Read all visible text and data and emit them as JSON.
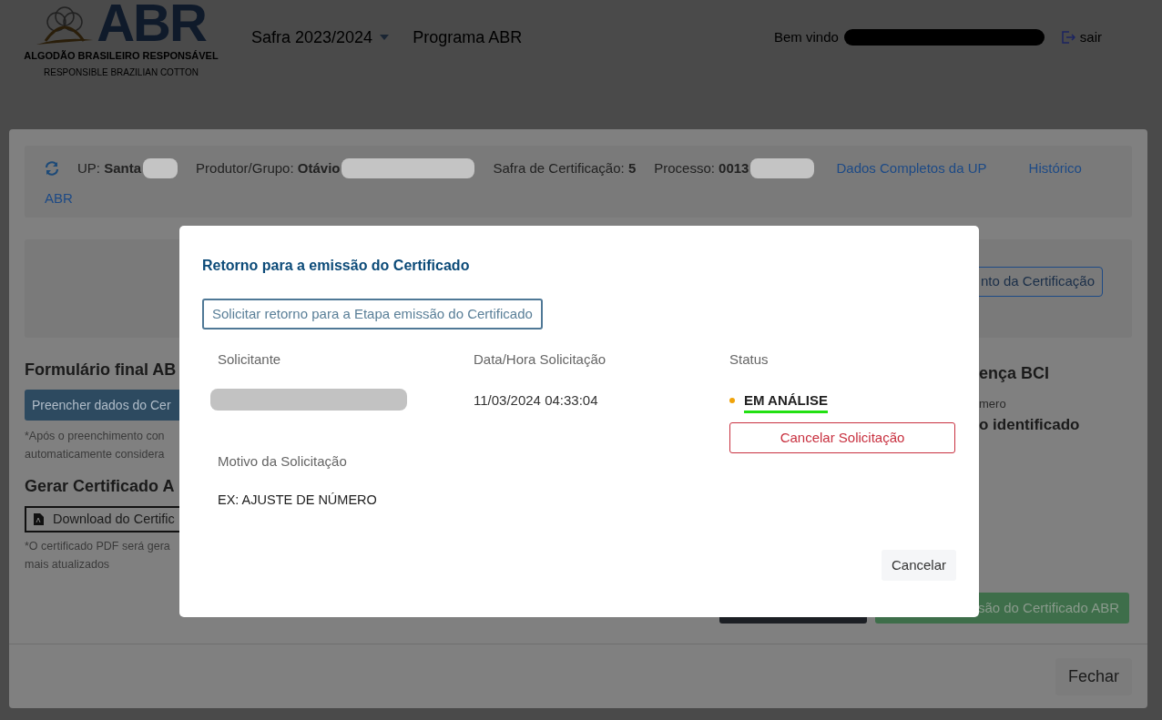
{
  "header": {
    "logo": {
      "mark": "ABR",
      "name": "ALGODÃO BRASILEIRO RESPONSÁVEL",
      "tagline": "RESPONSIBLE BRAZILIAN COTTON"
    },
    "nav": [
      {
        "label": "Safra 2023/2024",
        "kind": "dropdown"
      },
      {
        "label": "Programa ABR",
        "kind": "link"
      }
    ],
    "welcome": "Bem vindo",
    "logout": "sair"
  },
  "info_bar": {
    "fields": [
      {
        "label": "UP:",
        "value": "Santa"
      },
      {
        "label": "Produtor/Grupo:",
        "value": "Otávio"
      },
      {
        "label": "Safra de Certificação:",
        "value": "5"
      },
      {
        "label": "Processo:",
        "value": "0013"
      }
    ],
    "links": [
      "Dados Completos da UP",
      "Histórico"
    ],
    "wrapped_link": "ABR"
  },
  "panel_button": "nto da Certificação",
  "left": {
    "form_title": "Formulário final AB",
    "form_button": "Preencher dados do Cer",
    "form_note": [
      "*Após o preenchimento con",
      "automaticamente considera"
    ],
    "cert_title": "Gerar Certificado A",
    "download_button": "Download do Certific",
    "cert_note": [
      "*O certificado PDF será gera",
      "mais atualizados"
    ]
  },
  "right": {
    "title": "ença BCI",
    "label": "mero",
    "value": "o identificado"
  },
  "footer_buttons": [
    "são do Certificado ABR"
  ],
  "close_button": "Fechar",
  "dialog": {
    "title": "Retorno para a emissão do Certificado",
    "request_button": "Solicitar retorno para a Etapa emissão do Certificado",
    "columns": [
      "Solicitante",
      "Data/Hora Solicitação",
      "Status"
    ],
    "date": "11/03/2024 04:33:04",
    "status": {
      "label": "EM ANÁLISE",
      "color": "#f0a30a"
    },
    "cancel_request_button": "Cancelar Solicitação",
    "reason_label": "Motivo da Solicitação",
    "reason": "EX: AJUSTE DE NÚMERO",
    "cancel_button": "Cancelar"
  }
}
